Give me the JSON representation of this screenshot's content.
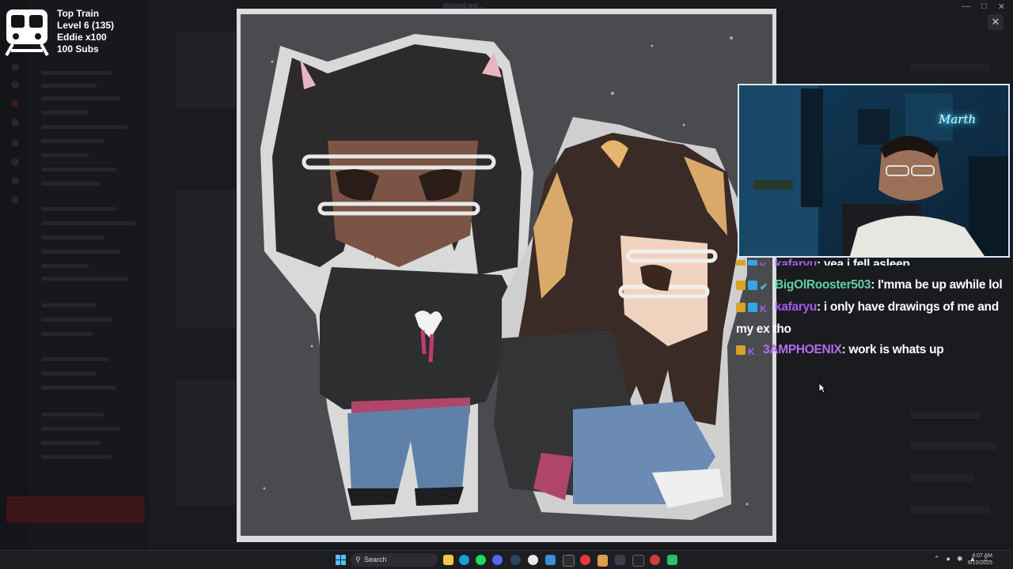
{
  "background_app": {
    "viewer_title": "discord.gg/..."
  },
  "train": {
    "title": "Top Train",
    "level": "Level 6  (135)",
    "top_contributor": "Eddie x100",
    "subs": "100 Subs"
  },
  "webcam": {
    "neon_sign": "Marth"
  },
  "chat": {
    "messages": [
      {
        "user": "kafaryu",
        "user_color": "#a45cf0",
        "text": ": yea i fell asleep",
        "badges": [
          "gold",
          "cube",
          "k"
        ]
      },
      {
        "user": "BigOlRooster503",
        "user_color": "#5fd1a4",
        "text": ": I'mma be up awhile lol",
        "badges": [
          "gold",
          "cube",
          "check"
        ]
      },
      {
        "user": "kafaryu",
        "user_color": "#a45cf0",
        "text": ": i only have drawings of me and my ex tho",
        "badges": [
          "gold",
          "cube",
          "k"
        ]
      },
      {
        "user": "3AMPHOENIX",
        "user_color": "#b66cf0",
        "text": ": work is whats up",
        "badges": [
          "gold",
          "k"
        ]
      }
    ]
  },
  "taskbar": {
    "search_placeholder": "Search",
    "time": "4:07 AM",
    "date": "8/10/2025"
  },
  "colors": {
    "accent": "#a45cf0",
    "webcam_border": "#dbe8ff",
    "taskbar": "#1d1e22"
  }
}
